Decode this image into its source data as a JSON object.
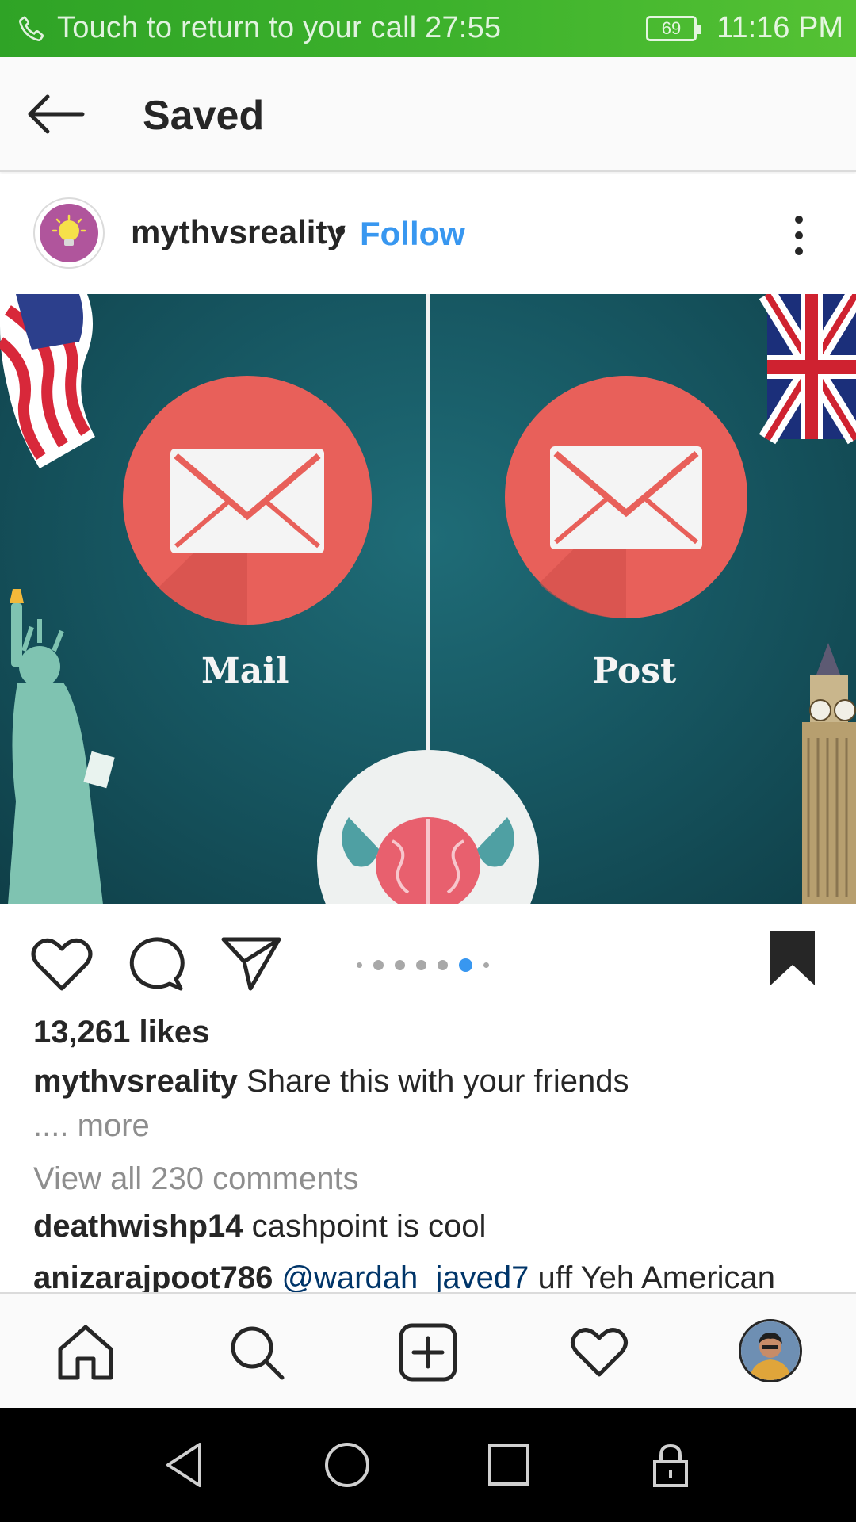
{
  "status_bar": {
    "call_text": "Touch to return to your call 27:55",
    "battery": "69",
    "time": "11:16 PM",
    "icons": [
      "phone-icon",
      "battery-icon"
    ]
  },
  "header": {
    "title": "Saved",
    "back_icon": "arrow-left-icon"
  },
  "post": {
    "username": "mythvsreality",
    "separator": "•",
    "follow_label": "Follow",
    "image": {
      "left_label": "Mail",
      "right_label": "Post"
    },
    "carousel": {
      "total": 7,
      "active_index": 5
    },
    "likes": "13,261 likes",
    "caption_user": "mythvsreality",
    "caption_text": " Share this with your friends",
    "caption_more": ".... more",
    "view_all_comments": "View all 230 comments",
    "comments": [
      {
        "user": "deathwishp14",
        "text": " cashpoint is cool"
      },
      {
        "user": "anizarajpoot786",
        "mention": " @wardah_javed7",
        "text": " uff Yeh American"
      }
    ]
  },
  "colors": {
    "status_green": "#3cb12c",
    "link_blue": "#3897f0",
    "text": "#262626",
    "muted": "#8e8e8e",
    "image_bg": "#175863",
    "envelope_circle": "#e8605a"
  },
  "tab_bar": {
    "icons": [
      "home-icon",
      "search-icon",
      "add-post-icon",
      "heart-icon",
      "profile-avatar"
    ]
  },
  "nav_bar": {
    "icons": [
      "back-triangle-icon",
      "home-circle-icon",
      "recents-square-icon",
      "lock-icon"
    ]
  }
}
